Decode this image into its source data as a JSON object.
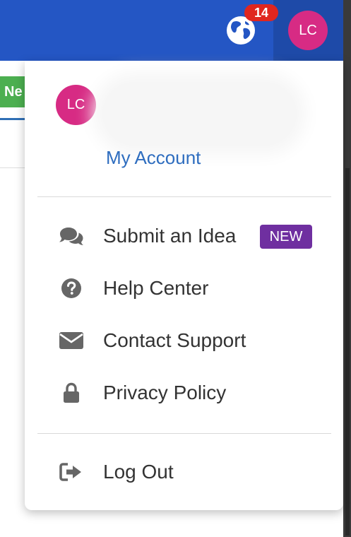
{
  "header": {
    "notification_count": "14",
    "avatar_initials": "LC",
    "bg_color": "#2456c4",
    "icons": [
      "globe-icon"
    ]
  },
  "background": {
    "new_button_label": "Ne"
  },
  "menu": {
    "avatar_initials": "LC",
    "account_link": "My Account",
    "items": [
      {
        "label": "Submit an Idea",
        "icon": "comments-icon",
        "badge": "NEW"
      },
      {
        "label": "Help Center",
        "icon": "question-circle-icon"
      },
      {
        "label": "Contact Support",
        "icon": "envelope-icon"
      },
      {
        "label": "Privacy Policy",
        "icon": "lock-icon"
      }
    ],
    "logout_label": "Log Out",
    "logout_icon": "sign-out-icon",
    "colors": {
      "avatar": "#d72b84",
      "link": "#2e6dbf",
      "new_badge": "#6f2fa0",
      "notification": "#e0261f"
    }
  }
}
